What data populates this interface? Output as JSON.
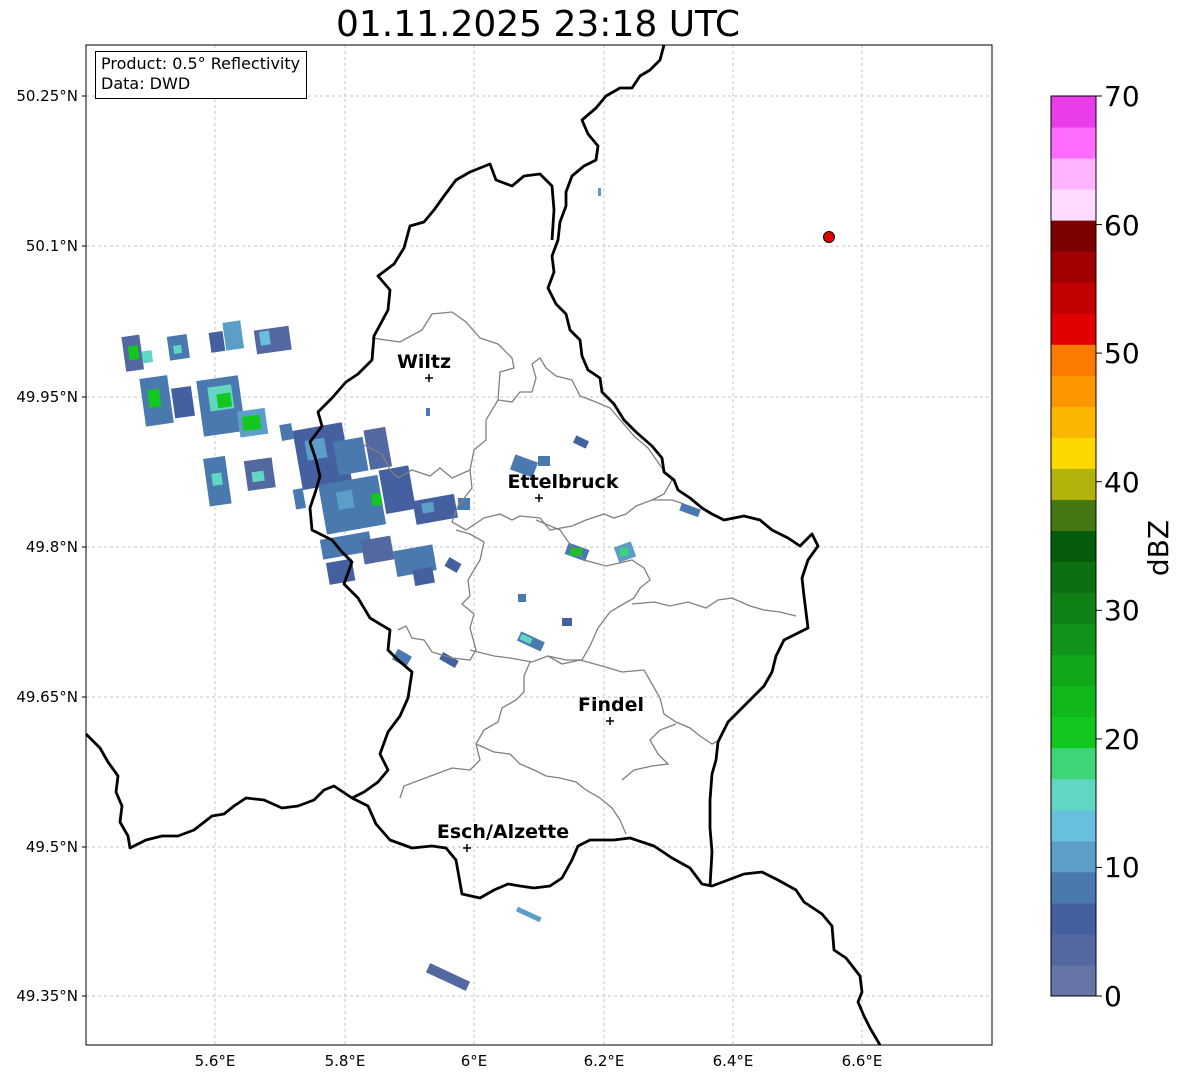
{
  "title": "01.11.2025 23:18 UTC",
  "info": {
    "product": "Product: 0.5° Reflectivity",
    "source": "Data: DWD"
  },
  "axes": {
    "lat_labels": [
      "50.25°N",
      "50.1°N",
      "49.95°N",
      "49.8°N",
      "49.65°N",
      "49.5°N",
      "49.35°N"
    ],
    "lon_labels": [
      "5.6°E",
      "5.8°E",
      "6°E",
      "6.2°E",
      "6.4°E",
      "6.6°E"
    ],
    "lon_range": [
      5.4,
      6.8
    ],
    "lat_range": [
      49.3,
      50.3
    ],
    "grid": true
  },
  "cities": [
    {
      "name": "Wiltz",
      "lon": 5.932,
      "lat": 49.967
    },
    {
      "name": "Ettelbruck",
      "lon": 6.104,
      "lat": 49.848
    },
    {
      "name": "Findel",
      "lon": 6.213,
      "lat": 49.627
    },
    {
      "name": "Esch/Alzette",
      "lon": 5.99,
      "lat": 49.499
    }
  ],
  "marker": {
    "lon": 6.55,
    "lat": 50.11,
    "color": "#e00000"
  },
  "colorbar": {
    "label": "dBZ",
    "min": 0,
    "max": 70,
    "ticks": [
      "0",
      "10",
      "20",
      "30",
      "40",
      "50",
      "60",
      "70"
    ],
    "colors": [
      "#6674a6",
      "#5367a0",
      "#4460a0",
      "#4a79b0",
      "#5b9fc8",
      "#67c1dd",
      "#61d6c3",
      "#3dd677",
      "#12c81e",
      "#11b81c",
      "#10a81a",
      "#0f9318",
      "#0e8016",
      "#0b7012",
      "#055c0a",
      "#477711",
      "#b0b30a",
      "#fcd800",
      "#fbb600",
      "#fe9600",
      "#fd7a00",
      "#e10000",
      "#c10000",
      "#a20000",
      "#7b0000",
      "#ffdcff",
      "#ffb4ff",
      "#ff6cff",
      "#ea3ce8"
    ]
  },
  "colors": {
    "border": "#000000",
    "cantons": "#808080",
    "grid": "#b0b0b0"
  }
}
